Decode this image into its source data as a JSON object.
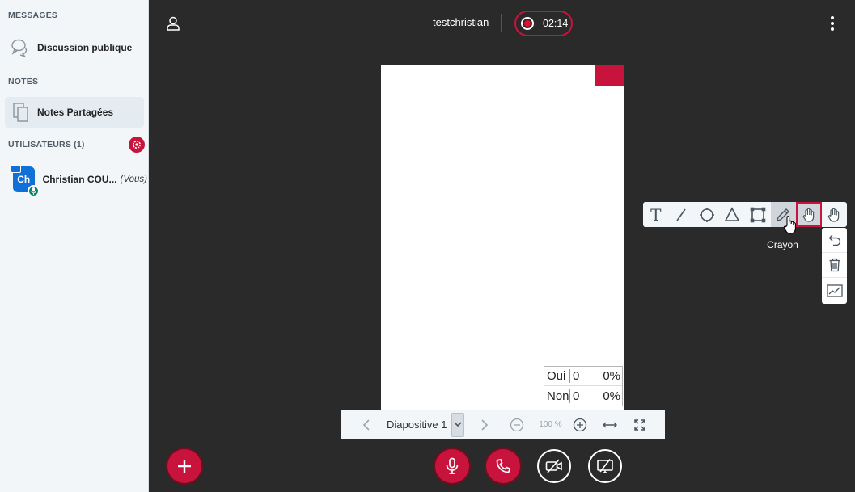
{
  "sidebar": {
    "messages_title": "MESSAGES",
    "public_chat_label": "Discussion publique",
    "notes_title": "NOTES",
    "shared_notes_label": "Notes Partagées",
    "users_title": "UTILISATEURS (1)",
    "user": {
      "initials": "Ch",
      "name": "Christian COU...",
      "you_label": "(Vous)"
    }
  },
  "header": {
    "meeting_name": "testchristian",
    "recording_time": "02:14"
  },
  "poll_results": [
    {
      "option": "Oui",
      "count": "0",
      "percent": "0%"
    },
    {
      "option": "Non",
      "count": "0",
      "percent": "0%"
    }
  ],
  "slide_nav": {
    "slide_label": "Diapositive 1",
    "zoom": "100 %"
  },
  "whiteboard": {
    "tooltip": "Crayon",
    "text_tool_glyph": "T"
  },
  "colors": {
    "accent": "#c8143c",
    "sidebar_bg": "#f3f6f9",
    "main_bg": "#2a2a2a",
    "avatar": "#0f70d7",
    "mic_badge": "#00886b"
  }
}
